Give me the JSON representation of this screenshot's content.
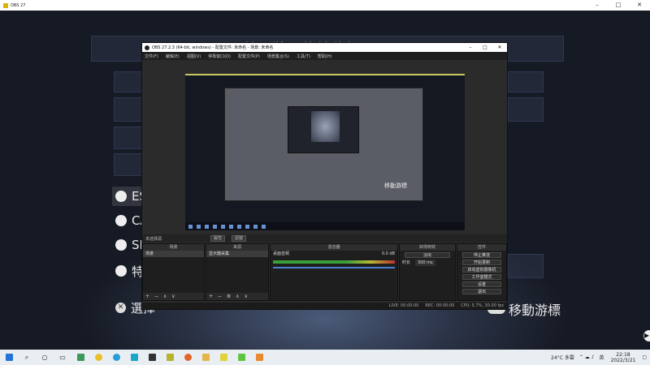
{
  "outer_window": {
    "title": "OBS 27",
    "controls": [
      "–",
      "□",
      "✕"
    ]
  },
  "background_app": {
    "title_fragment": "輸入裝置的鍵位設置",
    "menu_items": [
      {
        "label": "ES",
        "icon": "circle-icon"
      },
      {
        "label": "CA",
        "icon": "camera-icon"
      },
      {
        "label": "SH",
        "icon": "shift-icon"
      },
      {
        "label": "特",
        "icon": "person-icon"
      }
    ],
    "select_label": "選擇",
    "move_cursor_label": "移動游標",
    "side_button": "▶"
  },
  "obs": {
    "title": "OBS 27.2.3 (64-bit, windows) - 配置文件: 未命名 - 场景: 未命名",
    "menu": [
      "文件(F)",
      "编辑(E)",
      "视图(V)",
      "停靠窗口(D)",
      "配置文件(P)",
      "场景集合(S)",
      "工具(T)",
      "帮助(H)"
    ],
    "preview_caption": "移動游標",
    "source_bar": {
      "label": "未选择源",
      "props_button": "属性",
      "filter_button": "滤镜"
    },
    "docks": {
      "scenes": {
        "header": "场景",
        "items": [
          "场景"
        ]
      },
      "sources": {
        "header": "来源",
        "items": [
          "显示器采集"
        ]
      },
      "mixer": {
        "header": "混音器",
        "channel": "桌面音频",
        "level": "0.0 dB"
      },
      "transitions": {
        "header": "转场特效",
        "type": "淡出",
        "duration_label": "时长",
        "duration_value": "300 ms"
      },
      "controls": {
        "header": "控件",
        "buttons": [
          "停止推流",
          "开始录制",
          "启动虚拟摄像机",
          "工作室模式",
          "设置",
          "退出"
        ]
      }
    },
    "status": {
      "live": "LIVE: 00:00:00",
      "rec": "REC: 00:00:00",
      "cpu": "CPU: 5.7%, 30.00 fps"
    }
  },
  "taskbar": {
    "icons": [
      "start-icon",
      "search-icon",
      "task-view-icon",
      "widgets-icon",
      "explorer-icon",
      "store-icon",
      "edge-icon",
      "chrome-icon",
      "obs-icon",
      "app-icon",
      "folder-icon",
      "terminal-icon"
    ],
    "weather": "24°C 多雲",
    "lang": "英",
    "time": "22:18",
    "date": "2022/3/21"
  }
}
